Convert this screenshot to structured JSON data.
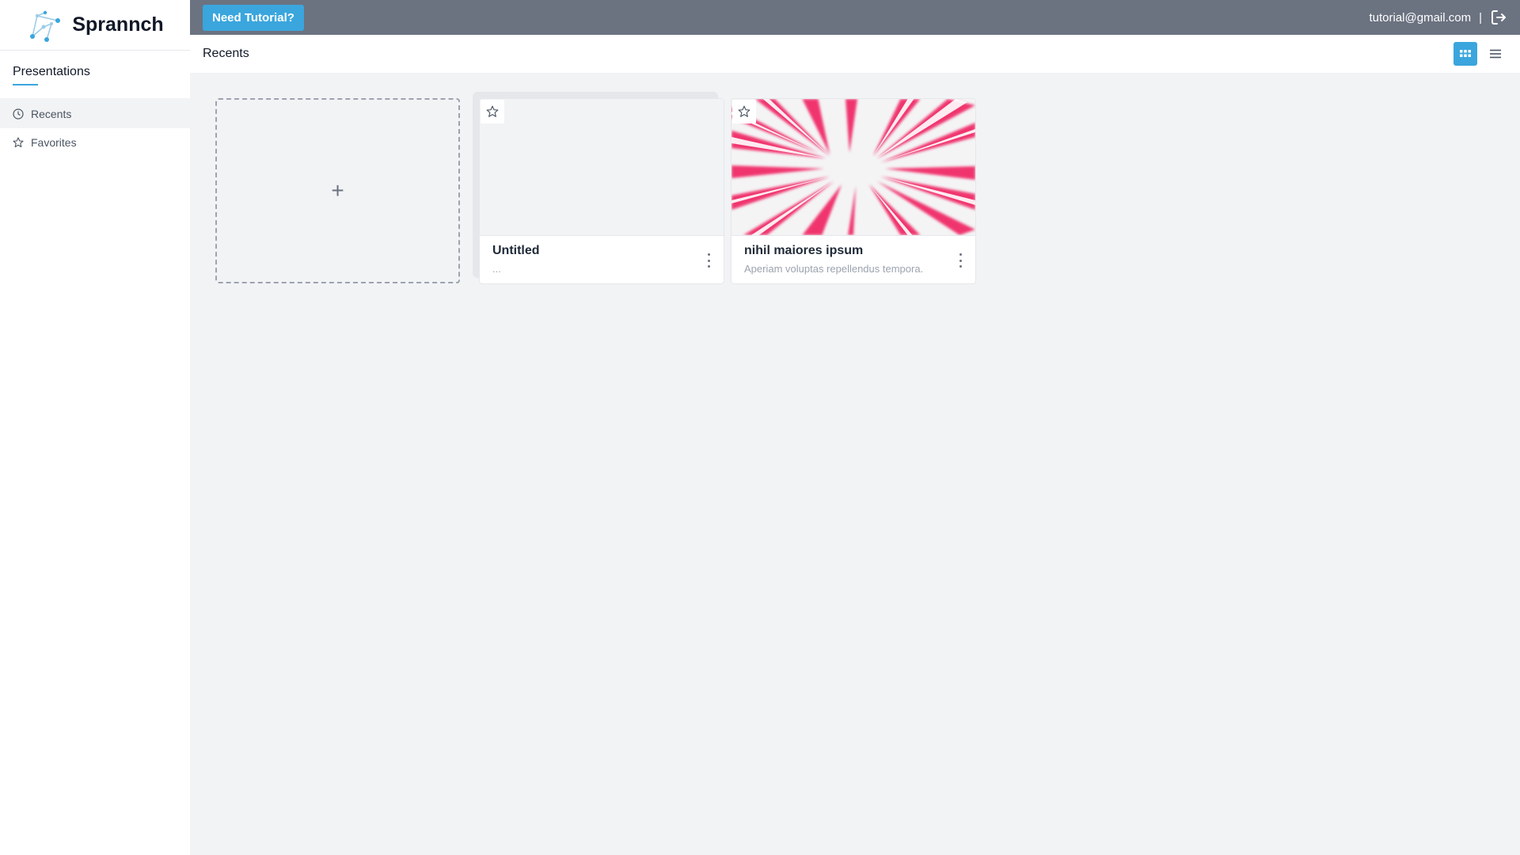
{
  "brand": {
    "name": "Sprannch"
  },
  "sidebar": {
    "section_title": "Presentations",
    "items": [
      {
        "label": "Recents",
        "icon": "clock-icon",
        "active": true
      },
      {
        "label": "Favorites",
        "icon": "star-icon",
        "active": false
      }
    ]
  },
  "topbar": {
    "tutorial_label": "Need Tutorial?",
    "email": "tutorial@gmail.com",
    "separator": "|"
  },
  "subheader": {
    "title": "Recents"
  },
  "cards": {
    "new_label": "+",
    "items": [
      {
        "title": "Untitled",
        "subtitle": "...",
        "thumbnail": "blank",
        "favorite": false
      },
      {
        "title": "nihil maiores ipsum",
        "subtitle": "Aperiam voluptas repellendus tempora.",
        "thumbnail": "pink-burst",
        "favorite": false
      }
    ]
  },
  "colors": {
    "accent": "#3aa6dd",
    "topbar": "#6b7280",
    "background": "#f2f3f5",
    "burst": "#f0346e"
  }
}
